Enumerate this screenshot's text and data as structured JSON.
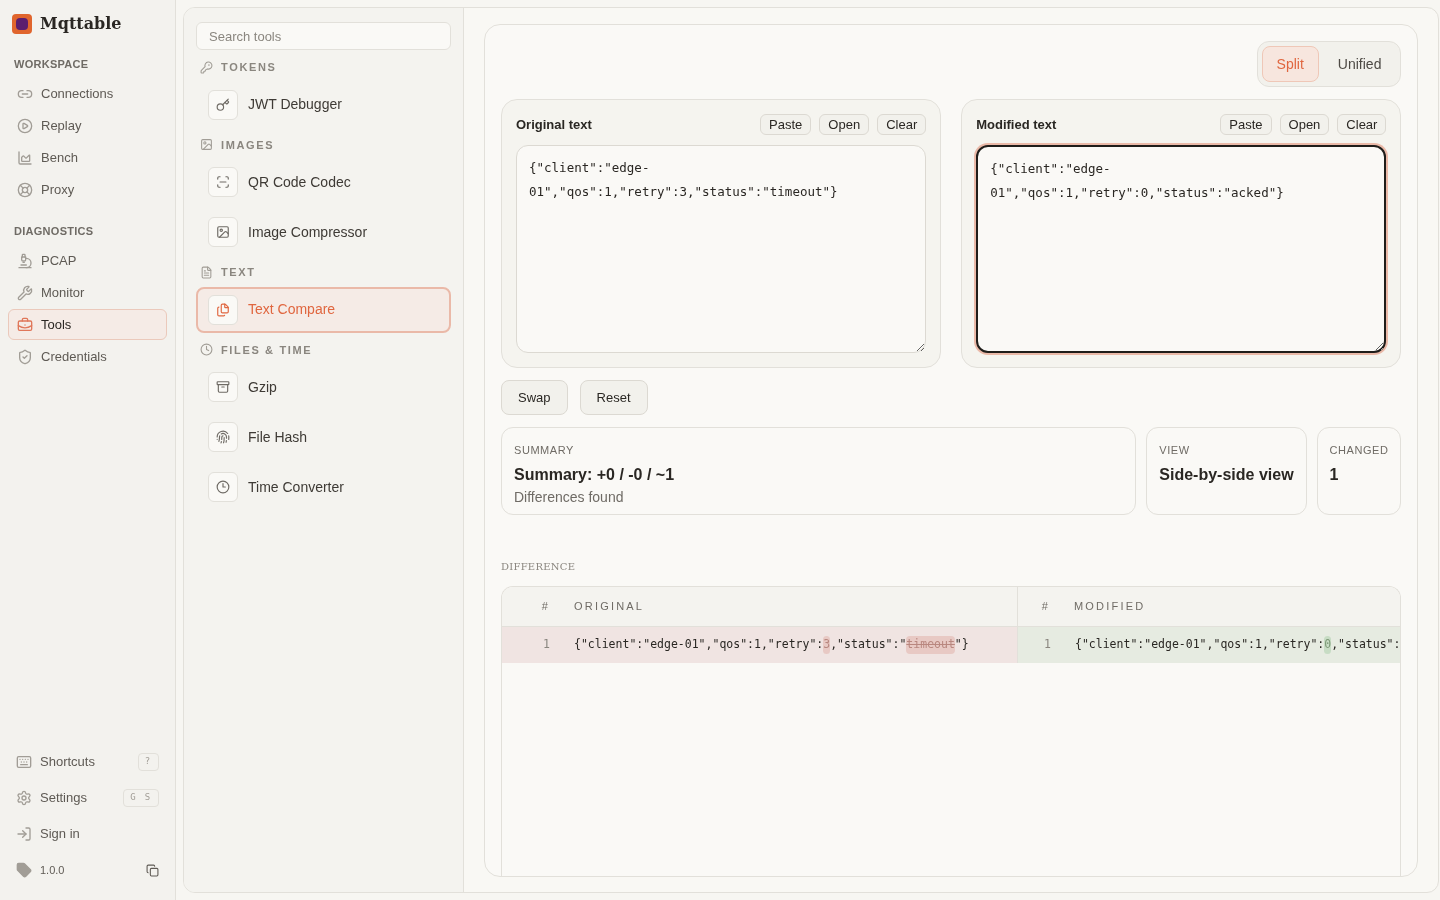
{
  "app": {
    "name": "Mqttable"
  },
  "sidebar": {
    "sections": [
      {
        "title": "WORKSPACE",
        "items": [
          {
            "label": "Connections",
            "selected": false
          },
          {
            "label": "Replay",
            "selected": false
          },
          {
            "label": "Bench",
            "selected": false
          },
          {
            "label": "Proxy",
            "selected": false
          }
        ]
      },
      {
        "title": "DIAGNOSTICS",
        "items": [
          {
            "label": "PCAP",
            "selected": false
          },
          {
            "label": "Monitor",
            "selected": false
          },
          {
            "label": "Tools",
            "selected": true
          },
          {
            "label": "Credentials",
            "selected": false
          }
        ]
      }
    ],
    "footer": [
      {
        "label": "Shortcuts",
        "keys": [
          "?"
        ]
      },
      {
        "label": "Settings",
        "keys": [
          "G",
          "S"
        ]
      },
      {
        "label": "Sign in"
      }
    ],
    "version": "1.0.0"
  },
  "tools": {
    "search": {
      "placeholder": "Search tools"
    },
    "groups": [
      {
        "title": "TOKENS",
        "items": [
          {
            "label": "JWT Debugger",
            "selected": false
          }
        ]
      },
      {
        "title": "IMAGES",
        "items": [
          {
            "label": "QR Code Codec",
            "selected": false
          },
          {
            "label": "Image Compressor",
            "selected": false
          }
        ]
      },
      {
        "title": "TEXT",
        "items": [
          {
            "label": "Text Compare",
            "selected": true
          }
        ]
      },
      {
        "title": "FILES & TIME",
        "items": [
          {
            "label": "Gzip",
            "selected": false
          },
          {
            "label": "File Hash",
            "selected": false
          },
          {
            "label": "Time Converter",
            "selected": false
          }
        ]
      }
    ]
  },
  "compare": {
    "view_toggle": [
      {
        "label": "Split",
        "selected": true
      },
      {
        "label": "Unified",
        "selected": false
      }
    ],
    "editors": [
      {
        "title": "Original text",
        "actions": [
          "Paste",
          "Open",
          "Clear"
        ],
        "value": "{\"client\":\"edge-01\",\"qos\":1,\"retry\":3,\"status\":\"timeout\"}",
        "focused": false
      },
      {
        "title": "Modified text",
        "actions": [
          "Paste",
          "Open",
          "Clear"
        ],
        "value": "{\"client\":\"edge-01\",\"qos\":1,\"retry\":0,\"status\":\"acked\"}",
        "focused": true
      }
    ],
    "buttons": [
      "Swap",
      "Reset"
    ],
    "stats": [
      {
        "label": "SUMMARY",
        "value": "Summary: +0 / -0 / ~1",
        "note": "Differences found"
      },
      {
        "label": "VIEW",
        "value": "Side-by-side view"
      },
      {
        "label": "CHANGED",
        "value": "1"
      }
    ],
    "diff": {
      "title": "DIFFERENCE",
      "columns": [
        "#",
        "ORIGINAL",
        "#",
        "MODIFIED"
      ],
      "rows": [
        {
          "number": "1",
          "original": [
            {
              "text": "{\"client\":\"edge-01\",\"qos\":1,\"retry\":",
              "kind": "same"
            },
            {
              "text": "3",
              "kind": "removed"
            },
            {
              "text": ",\"status\":\"",
              "kind": "same"
            },
            {
              "text": "timeout",
              "kind": "removed"
            },
            {
              "text": "\"}",
              "kind": "same"
            }
          ],
          "modified_number": "1",
          "modified": [
            {
              "text": "{\"client\":\"edge-01\",\"qos\":1,\"retry\":",
              "kind": "same"
            },
            {
              "text": "0",
              "kind": "added"
            },
            {
              "text": ",\"status\":",
              "kind": "same"
            }
          ]
        }
      ]
    }
  }
}
